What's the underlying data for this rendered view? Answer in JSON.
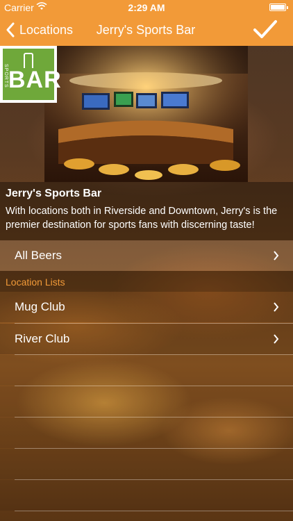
{
  "status_bar": {
    "carrier": "Carrier",
    "time": "2:29 AM",
    "battery_level": 1.0
  },
  "nav": {
    "back_label": "Locations",
    "title": "Jerry's Sports Bar",
    "done_icon": "checkmark-icon"
  },
  "logo": {
    "side_text": "SPORTS",
    "letters": "BAR"
  },
  "venue": {
    "name": "Jerry's Sports Bar",
    "description": "With locations both in Riverside and Downtown, Jerry's is the premier destination for sports fans with discerning taste!"
  },
  "all_beers": {
    "label": "All Beers"
  },
  "location_lists": {
    "header": "Location Lists",
    "items": [
      {
        "label": "Mug Club"
      },
      {
        "label": "River Club"
      }
    ]
  },
  "colors": {
    "accent": "#f29a38"
  }
}
